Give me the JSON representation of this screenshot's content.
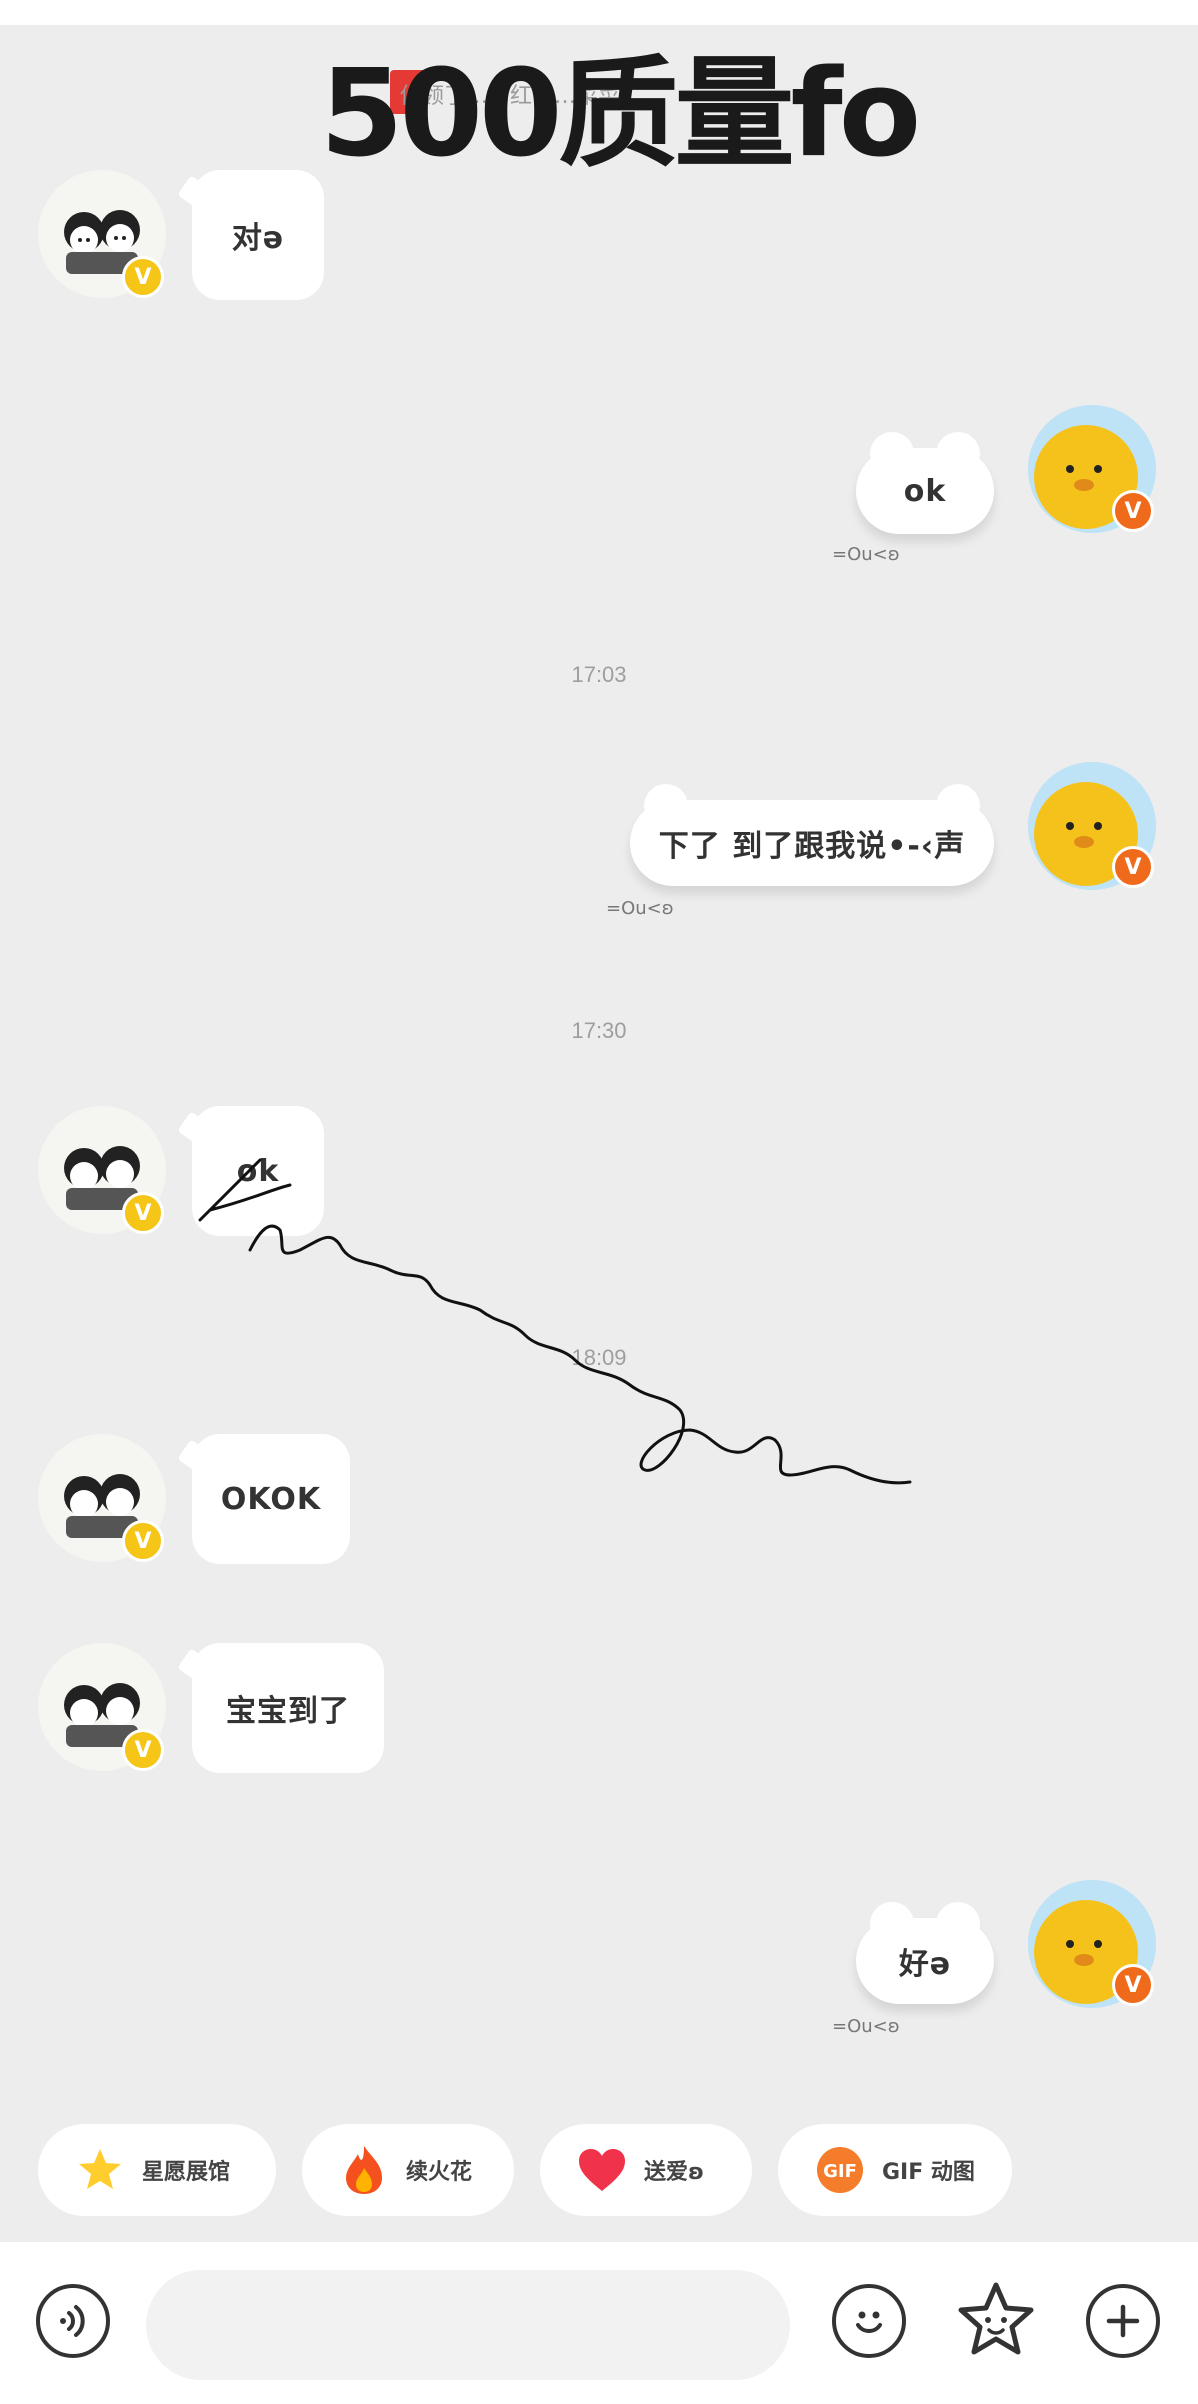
{
  "overlay": {
    "title": "500质量fo",
    "notice": "你领了…的红包…菜菜…"
  },
  "messages": [
    {
      "side": "in",
      "text": "对ə"
    },
    {
      "side": "out",
      "text": "ok",
      "footer": "=Ou<ʚ"
    },
    {
      "side": "out",
      "text": "下了 到了跟我说•-‹声",
      "footer": "=Ou<ʚ"
    },
    {
      "side": "in",
      "text": "ok"
    },
    {
      "side": "in",
      "text": "OKOK"
    },
    {
      "side": "in",
      "text": "宝宝到了"
    },
    {
      "side": "out",
      "text": "好ə",
      "footer": "=Ou<ʚ"
    }
  ],
  "timestamps": [
    "17:03",
    "17:30",
    "18:09"
  ],
  "quick_actions": [
    {
      "label": "星愿展馆",
      "icon": "star-icon"
    },
    {
      "label": "续火花",
      "icon": "fire-icon"
    },
    {
      "label": "送爱ʚ",
      "icon": "heart-icon"
    },
    {
      "label": "GIF 动图",
      "icon": "gif-icon"
    }
  ],
  "input_bar": {
    "placeholder": "",
    "buttons": [
      "voice-icon",
      "emoji-icon",
      "sticker-icon",
      "plus-icon"
    ]
  },
  "colors": {
    "background": "#ededed",
    "bubble": "#ffffff",
    "verified_left": "#f5c518",
    "verified_right": "#f06a1c"
  }
}
